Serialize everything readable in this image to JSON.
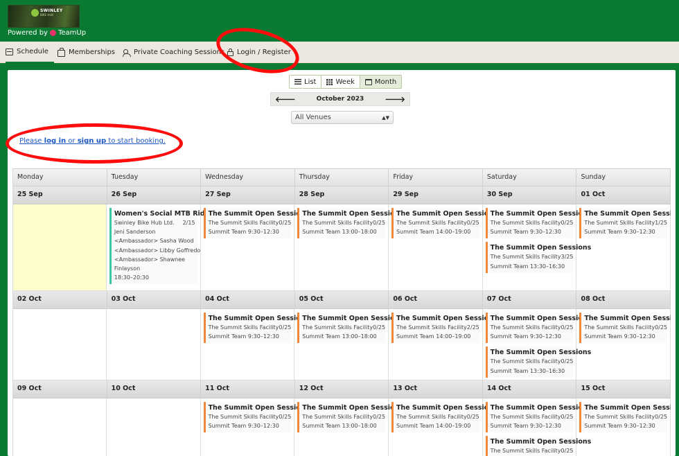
{
  "brand": {
    "powered_by": "Powered by",
    "teamup": "TeamUp",
    "logo_text": "SWINLEY",
    "logo_sub": "BIKE HUB"
  },
  "nav": [
    {
      "label": "Schedule",
      "icon": "calendar-icon",
      "active": true
    },
    {
      "label": "Memberships",
      "icon": "bag-icon",
      "active": false
    },
    {
      "label": "Private Coaching Sessions",
      "icon": "users-icon",
      "active": false
    },
    {
      "label": "Login / Register",
      "icon": "lock-icon",
      "active": false
    }
  ],
  "views": [
    {
      "label": "List",
      "icon": "list-icon"
    },
    {
      "label": "Week",
      "icon": "grid-icon"
    },
    {
      "label": "Month",
      "icon": "month-icon",
      "active": true
    }
  ],
  "month_nav": {
    "label": "October 2023",
    "prev": "🡐",
    "next": "🡒"
  },
  "venue_select": {
    "value": "All Venues"
  },
  "login_prompt": {
    "before": "Please ",
    "login": "log in",
    "middle": " or ",
    "signup": "sign up",
    "after": " to start booking."
  },
  "annotation_color": "#ff0d0d",
  "weekday_headers": [
    "Monday",
    "Tuesday",
    "Wednesday",
    "Thursday",
    "Friday",
    "Saturday",
    "Sunday"
  ],
  "weeks": [
    {
      "dates": [
        "25 Sep",
        "26 Sep",
        "27 Sep",
        "28 Sep",
        "29 Sep",
        "30 Sep",
        "01 Oct"
      ],
      "height": 125,
      "days": [
        {
          "today": true,
          "events": []
        },
        {
          "events": [
            {
              "title": "Women's Social MTB Ride",
              "venue": "Swinley Bike Hub Ltd.",
              "count": "2/15",
              "lines": [
                "Jeni Sanderson",
                "<Ambassador> Sasha Wood",
                "<Ambassador> Libby Goffredo",
                "<Ambassador> Shawnee",
                "Finlayson",
                "18:30–20:30"
              ],
              "color": "green"
            }
          ]
        },
        {
          "events": [
            {
              "title": "The Summit Open Sessions",
              "venue": "The Summit Skills Facility",
              "count": "0/25",
              "lines": [
                "Summit Team 9:30–12:30"
              ]
            }
          ]
        },
        {
          "events": [
            {
              "title": "The Summit Open Sessions",
              "venue": "The Summit Skills Facility",
              "count": "0/25",
              "lines": [
                "Summit Team 13:00–18:00"
              ]
            }
          ]
        },
        {
          "events": [
            {
              "title": "The Summit Open Sessions",
              "venue": "The Summit Skills Facility",
              "count": "0/25",
              "lines": [
                "Summit Team 14:00–19:00"
              ]
            }
          ]
        },
        {
          "events": [
            {
              "title": "The Summit Open Sessions",
              "venue": "The Summit Skills Facility",
              "count": "0/25",
              "lines": [
                "Summit Team 9:30–12:30"
              ]
            },
            {
              "title": "The Summit Open Sessions",
              "venue": "The Summit Skills Facility",
              "count": "3/25",
              "lines": [
                "Summit Team 13:30–16:30"
              ]
            }
          ]
        },
        {
          "events": [
            {
              "title": "The Summit Open Sessions",
              "venue": "The Summit Skills Facility",
              "count": "1/25",
              "lines": [
                "Summit Team 9:30–12:30"
              ]
            }
          ]
        }
      ]
    },
    {
      "dates": [
        "02 Oct",
        "03 Oct",
        "04 Oct",
        "05 Oct",
        "06 Oct",
        "07 Oct",
        "08 Oct"
      ],
      "height": 103,
      "days": [
        {
          "events": []
        },
        {
          "events": []
        },
        {
          "events": [
            {
              "title": "The Summit Open Sessions",
              "venue": "The Summit Skills Facility",
              "count": "0/25",
              "lines": [
                "Summit Team 9:30–12:30"
              ]
            }
          ]
        },
        {
          "events": [
            {
              "title": "The Summit Open Sessions",
              "venue": "The Summit Skills Facility",
              "count": "0/25",
              "lines": [
                "Summit Team 13:00–18:00"
              ]
            }
          ]
        },
        {
          "events": [
            {
              "title": "The Summit Open Sessions",
              "venue": "The Summit Skills Facility",
              "count": "2/25",
              "lines": [
                "Summit Team 14:00–19:00"
              ]
            }
          ]
        },
        {
          "events": [
            {
              "title": "The Summit Open Sessions",
              "venue": "The Summit Skills Facility",
              "count": "0/25",
              "lines": [
                "Summit Team 9:30–12:30"
              ]
            },
            {
              "title": "The Summit Open Sessions",
              "venue": "The Summit Skills Facility",
              "count": "0/25",
              "lines": [
                "Summit Team 13:30–16:30"
              ]
            }
          ]
        },
        {
          "events": [
            {
              "title": "The Summit Open Sessions",
              "venue": "The Summit Skills Facility",
              "count": "0/25",
              "lines": [
                "Summit Team 9:30–12:30"
              ]
            }
          ]
        }
      ]
    },
    {
      "dates": [
        "09 Oct",
        "10 Oct",
        "11 Oct",
        "12 Oct",
        "13 Oct",
        "14 Oct",
        "15 Oct"
      ],
      "height": 110,
      "days": [
        {
          "events": []
        },
        {
          "events": []
        },
        {
          "events": [
            {
              "title": "The Summit Open Sessions",
              "venue": "The Summit Skills Facility",
              "count": "0/25",
              "lines": [
                "Summit Team 9:30–12:30"
              ]
            }
          ]
        },
        {
          "events": [
            {
              "title": "The Summit Open Sessions",
              "venue": "The Summit Skills Facility",
              "count": "0/25",
              "lines": [
                "Summit Team 13:00–18:00"
              ]
            }
          ]
        },
        {
          "events": [
            {
              "title": "The Summit Open Sessions",
              "venue": "The Summit Skills Facility",
              "count": "0/25",
              "lines": [
                "Summit Team 14:00–19:00"
              ]
            }
          ]
        },
        {
          "events": [
            {
              "title": "The Summit Open Sessions",
              "venue": "The Summit Skills Facility",
              "count": "0/25",
              "lines": [
                "Summit Team 9:30–12:30"
              ]
            },
            {
              "title": "The Summit Open Sessions",
              "venue": "The Summit Skills Facility",
              "count": "0/25",
              "lines": []
            }
          ]
        },
        {
          "events": [
            {
              "title": "The Summit Open Sessions",
              "venue": "The Summit Skills Facility",
              "count": "0/25",
              "lines": [
                "Summit Team 9:30–12:30"
              ]
            }
          ]
        }
      ]
    }
  ]
}
